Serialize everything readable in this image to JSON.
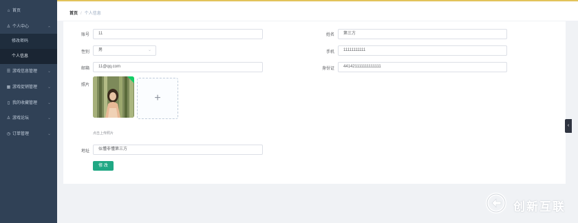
{
  "sidebar": {
    "items": [
      {
        "label": "首页",
        "icon": "home-icon",
        "glyph": "⌂",
        "chevron": false
      },
      {
        "label": "个人中心",
        "icon": "user-icon",
        "glyph": "♙",
        "chevron": true
      },
      {
        "label": "游戏信息管理",
        "icon": "list-icon",
        "glyph": "☰",
        "chevron": true
      },
      {
        "label": "游戏促销管理",
        "icon": "grid-icon",
        "glyph": "▦",
        "chevron": true
      },
      {
        "label": "我的收藏管理",
        "icon": "bookmark-icon",
        "glyph": "▯",
        "chevron": true
      },
      {
        "label": "游戏论坛",
        "icon": "user-icon",
        "glyph": "♙",
        "chevron": true
      },
      {
        "label": "订单管理",
        "icon": "clock-icon",
        "glyph": "◷",
        "chevron": true
      }
    ],
    "sub_items": [
      {
        "label": "修改密码"
      },
      {
        "label": "个人信息"
      }
    ],
    "chevron_glyph": "⌄"
  },
  "breadcrumb": {
    "home": "首页",
    "sep": "/",
    "current": "个人信息"
  },
  "form": {
    "account_label": "账号",
    "account_value": "11",
    "name_label": "姓名",
    "name_value": "第三方",
    "gender_label": "性别",
    "gender_value": "男",
    "phone_label": "手机",
    "phone_value": "11111111111",
    "email_label": "邮箱",
    "email_value": "11@qq.com",
    "idcard_label": "身份证",
    "idcard_value": "441421111111111111",
    "photo_label": "照片",
    "upload_hint": "点击上传照片",
    "address_label": "地址",
    "address_value": "似懂非懂第三方",
    "submit_label": "修 改"
  },
  "collapse_tab": "‹",
  "watermark": {
    "text": "创新互联"
  },
  "colors": {
    "sidebar_bg": "#304156",
    "accent": "#20a884",
    "top_line": "#e2c35a"
  }
}
